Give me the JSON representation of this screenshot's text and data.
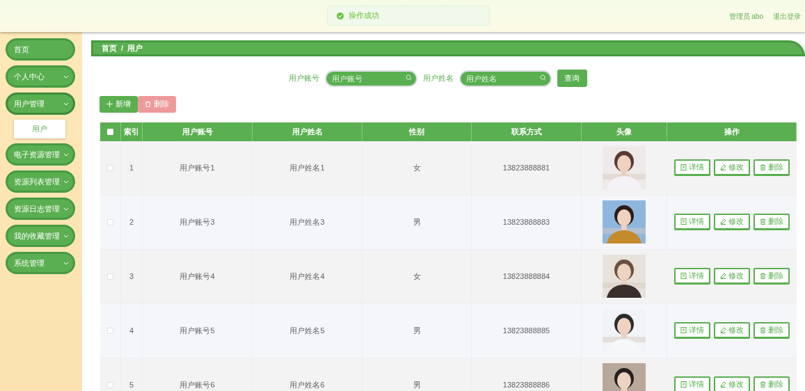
{
  "toast": {
    "message": "操作成功"
  },
  "header": {
    "user": "管理员 abo",
    "logout": "退出登录"
  },
  "sidebar": {
    "items": [
      {
        "label": "首页",
        "has_children": false,
        "expanded": false
      },
      {
        "label": "个人中心",
        "has_children": true,
        "expanded": false
      },
      {
        "label": "用户管理",
        "has_children": true,
        "expanded": true,
        "children": [
          {
            "label": "用户"
          }
        ]
      },
      {
        "label": "电子资源管理",
        "has_children": true,
        "expanded": false
      },
      {
        "label": "资源列表管理",
        "has_children": true,
        "expanded": false
      },
      {
        "label": "资源日志管理",
        "has_children": true,
        "expanded": false
      },
      {
        "label": "我的收藏管理",
        "has_children": true,
        "expanded": false
      },
      {
        "label": "系统管理",
        "has_children": true,
        "expanded": false
      }
    ]
  },
  "breadcrumb": [
    "首页",
    "用户"
  ],
  "breadcrumb_separator": "/",
  "search": {
    "fields": [
      {
        "label": "用户账号",
        "placeholder": "用户账号"
      },
      {
        "label": "用户姓名",
        "placeholder": "用户姓名"
      }
    ],
    "button": "查询"
  },
  "actions": [
    {
      "label": "新增",
      "kind": "add",
      "disabled": false
    },
    {
      "label": "删除",
      "kind": "delete",
      "disabled": true
    }
  ],
  "table": {
    "all_checked": false,
    "columns": [
      "索引",
      "用户账号",
      "用户姓名",
      "性别",
      "联系方式",
      "头像",
      "操作"
    ],
    "rows": [
      {
        "checked": false,
        "index": "1",
        "account": "用户账号1",
        "name": "用户姓名1",
        "gender": "女",
        "phone": "13823888881",
        "actions": [
          {
            "label": "详情",
            "kind": "detail"
          },
          {
            "label": "修改",
            "kind": "edit"
          },
          {
            "label": "删除",
            "kind": "delete"
          }
        ]
      },
      {
        "checked": false,
        "index": "2",
        "account": "用户账号3",
        "name": "用户姓名3",
        "gender": "男",
        "phone": "13823888883",
        "actions": [
          {
            "label": "详情",
            "kind": "detail"
          },
          {
            "label": "修改",
            "kind": "edit"
          },
          {
            "label": "删除",
            "kind": "delete"
          }
        ]
      },
      {
        "checked": false,
        "index": "3",
        "account": "用户账号4",
        "name": "用户姓名4",
        "gender": "女",
        "phone": "13823888884",
        "actions": [
          {
            "label": "详情",
            "kind": "detail"
          },
          {
            "label": "修改",
            "kind": "edit"
          },
          {
            "label": "删除",
            "kind": "delete"
          }
        ]
      },
      {
        "checked": false,
        "index": "4",
        "account": "用户账号5",
        "name": "用户姓名5",
        "gender": "男",
        "phone": "13823888885",
        "actions": [
          {
            "label": "详情",
            "kind": "detail"
          },
          {
            "label": "修改",
            "kind": "edit"
          },
          {
            "label": "删除",
            "kind": "delete"
          }
        ]
      },
      {
        "checked": false,
        "index": "5",
        "account": "用户账号6",
        "name": "用户姓名6",
        "gender": "男",
        "phone": "13823888886",
        "actions": [
          {
            "label": "详情",
            "kind": "detail"
          },
          {
            "label": "修改",
            "kind": "edit"
          },
          {
            "label": "删除",
            "kind": "delete"
          }
        ]
      }
    ]
  }
}
